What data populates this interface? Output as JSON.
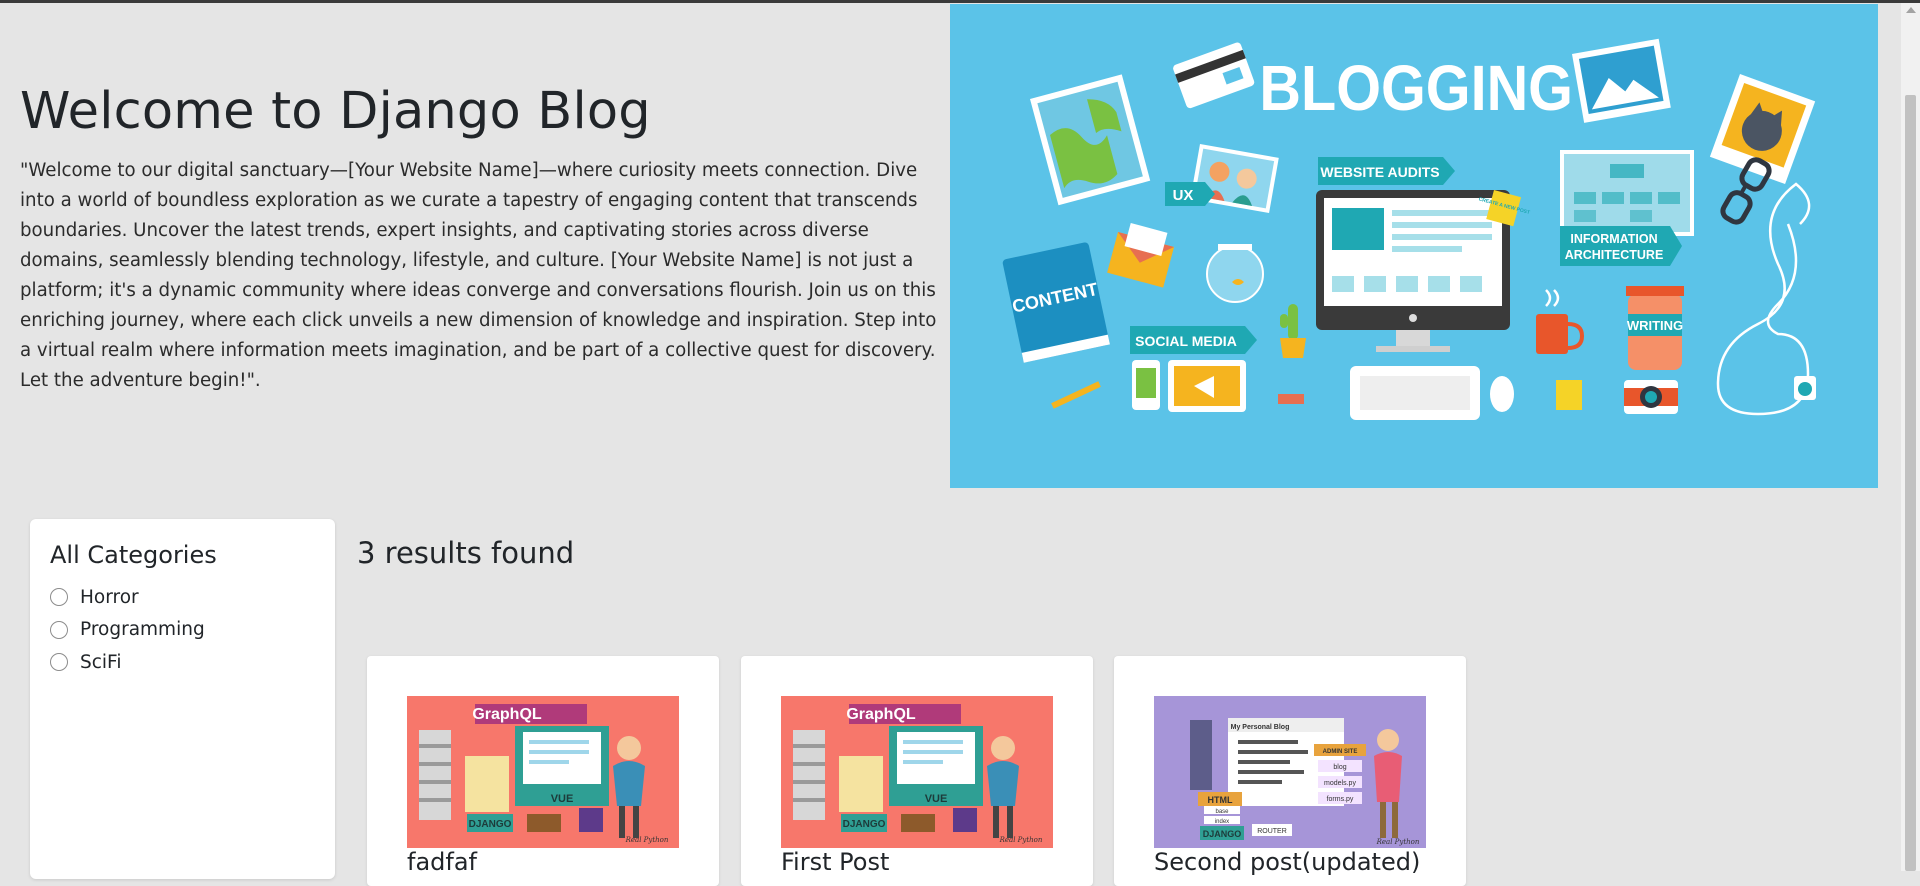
{
  "hero": {
    "title": "Welcome to Django Blog",
    "text": "\"Welcome to our digital sanctuary—[Your Website Name]—where curiosity meets connection. Dive into a world of boundless exploration as we curate a tapestry of engaging content that transcends boundaries. Uncover the latest trends, expert insights, and captivating stories across diverse domains, seamlessly blending technology, lifestyle, and culture. [Your Website Name] is not just a platform; it's a dynamic community where ideas converge and conversations flourish. Join us on this enriching journey, where each click unveils a new dimension of knowledge and inspiration. Step into a virtual realm where information meets imagination, and be part of a collective quest for discovery. Let the adventure begin!\".",
    "image": {
      "heading": "BLOGGING",
      "labels": {
        "website_audits": "WEBSITE AUDITS",
        "ux": "UX",
        "info_line1": "INFORMATION",
        "info_line2": "ARCHITECTURE",
        "content": "CONTENT",
        "social_media": "SOCIAL MEDIA",
        "writing": "WRITING",
        "create_post": "CREATE A NEW POST"
      }
    }
  },
  "sidebar": {
    "title": "All Categories",
    "categories": [
      {
        "label": "Horror"
      },
      {
        "label": "Programming"
      },
      {
        "label": "SciFi"
      }
    ]
  },
  "results": {
    "count_text": "3 results found",
    "posts": [
      {
        "title": "fadfaf",
        "thumb": "graphql-vue-django",
        "thumb_bg": "#f7776b"
      },
      {
        "title": "First Post",
        "thumb": "graphql-vue-django",
        "thumb_bg": "#f7776b"
      },
      {
        "title": "Second post(updated)",
        "thumb": "personal-blog-django",
        "thumb_bg": "#a695d8"
      }
    ],
    "thumb_text": {
      "graphql": "GraphQL",
      "vue": "VUE",
      "django": "DJANGO",
      "signature": "Real Python",
      "my_blog": "My Personal Blog",
      "admin_site": "ADMIN SITE",
      "blog": "blog",
      "models": "models.py",
      "forms": "forms.py",
      "html": "HTML",
      "base": "base",
      "index": "index",
      "router": "ROUTER"
    }
  },
  "colors": {
    "page_bg": "#e5e5e5",
    "hero_bg": "#5bc3e8",
    "accent_teal": "#1fa8b3",
    "card_bg": "#ffffff"
  }
}
